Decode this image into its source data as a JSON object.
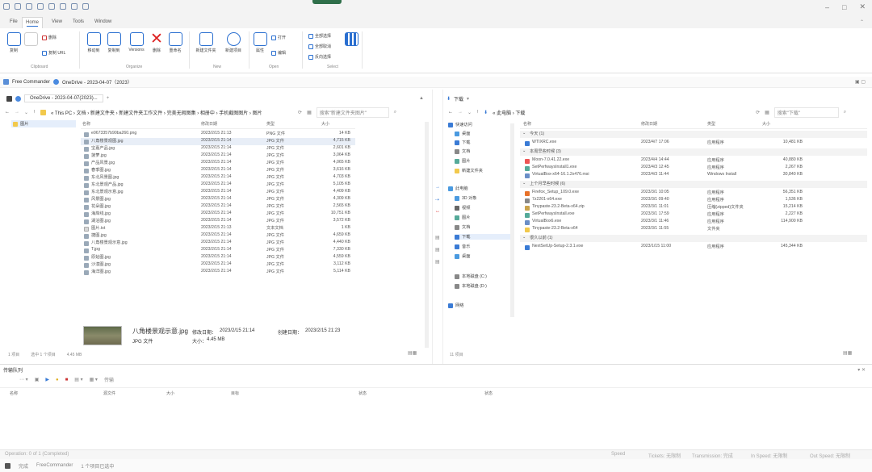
{
  "menu": {
    "file": "File",
    "home": "Home",
    "view": "View",
    "tools": "Tools",
    "window": "Window"
  },
  "ribbon": {
    "buttons": [
      "复制",
      "剪切",
      "移动到",
      "复制到",
      "Versions",
      "删除",
      "重命名",
      "新建文件夹",
      "新建项目",
      "属性"
    ],
    "small": [
      "删除",
      "复制 URL",
      "打开",
      "编辑",
      "全部选择",
      "全部取消",
      "反向选择"
    ],
    "groups": [
      "Clipboard",
      "Organize",
      "New",
      "Open",
      "Select"
    ],
    "sync_label": "同步",
    "partial": "Partial\nsel."
  },
  "address": {
    "text": "Free Commander",
    "cloud": "OneDrive - 2023-04-07（2023）"
  },
  "left": {
    "tab": "OneDrive - 2023-04-07(2023)...",
    "breadcrumb": "« This PC › 文档 › 新建文件夹 › 新建文件夹工作文件 › 完美无瑕图集 › 相册中 › 手机截图图片 › 图片",
    "search_placeholder": "搜索\"新建文件夹图片\"",
    "tree_root": "图片",
    "headers": [
      "名称",
      "修改日期",
      "类型",
      "大小"
    ],
    "files": [
      {
        "name": "e0673357b90ba260.png",
        "date": "2023/2/15 21:13",
        "type": "PNG 文件",
        "size": "14 KB",
        "icon": "img"
      },
      {
        "name": "八角楼景观图.jpg",
        "date": "2023/2/15 21:14",
        "type": "JPG 文件",
        "size": "4,715 KB",
        "icon": "img"
      },
      {
        "name": "宝嘉产品.jpg",
        "date": "2023/2/15 21:14",
        "type": "JPG 文件",
        "size": "2,601 KB",
        "icon": "img"
      },
      {
        "name": "菠萝.jpg",
        "date": "2023/2/15 21:14",
        "type": "JPG 文件",
        "size": "3,064 KB",
        "icon": "img"
      },
      {
        "name": "产品风景.jpg",
        "date": "2023/2/15 21:14",
        "type": "JPG 文件",
        "size": "4,065 KB",
        "icon": "img"
      },
      {
        "name": "春季图.jpg",
        "date": "2023/2/15 21:14",
        "type": "JPG 文件",
        "size": "3,616 KB",
        "icon": "img"
      },
      {
        "name": "东北风景图.jpg",
        "date": "2023/2/15 21:14",
        "type": "JPG 文件",
        "size": "4,703 KB",
        "icon": "img"
      },
      {
        "name": "东北景观产品.jpg",
        "date": "2023/2/15 21:14",
        "type": "JPG 文件",
        "size": "5,105 KB",
        "icon": "img"
      },
      {
        "name": "东北景观示意.jpg",
        "date": "2023/2/15 21:14",
        "type": "JPG 文件",
        "size": "4,409 KB",
        "icon": "img"
      },
      {
        "name": "风景图.jpg",
        "date": "2023/2/15 21:14",
        "type": "JPG 文件",
        "size": "4,309 KB",
        "icon": "img"
      },
      {
        "name": "花朵图.jpg",
        "date": "2023/2/15 21:14",
        "type": "JPG 文件",
        "size": "2,565 KB",
        "icon": "img"
      },
      {
        "name": "海岸线.jpg",
        "date": "2023/2/15 21:14",
        "type": "JPG 文件",
        "size": "10,751 KB",
        "icon": "img"
      },
      {
        "name": "湖泊图.jpg",
        "date": "2023/2/15 21:14",
        "type": "JPG 文件",
        "size": "3,572 KB",
        "icon": "img"
      },
      {
        "name": "图片.txt",
        "date": "2023/2/15 21:13",
        "type": "文本文档",
        "size": "1 KB",
        "icon": "txt"
      },
      {
        "name": "捷图.jpg",
        "date": "2023/2/15 21:14",
        "type": "JPG 文件",
        "size": "4,659 KB",
        "icon": "img"
      },
      {
        "name": "八角楼景观示意.jpg",
        "date": "2023/2/15 21:14",
        "type": "JPG 文件",
        "size": "4,440 KB",
        "icon": "img"
      },
      {
        "name": "T.jpg",
        "date": "2023/2/15 21:14",
        "type": "JPG 文件",
        "size": "7,330 KB",
        "icon": "img"
      },
      {
        "name": "原始图.jpg",
        "date": "2023/2/15 21:14",
        "type": "JPG 文件",
        "size": "4,559 KB",
        "icon": "img"
      },
      {
        "name": "沙漠图.jpg",
        "date": "2023/2/15 21:14",
        "type": "JPG 文件",
        "size": "3,112 KB",
        "icon": "img"
      },
      {
        "name": "海洋图.jpg",
        "date": "2023/2/15 21:14",
        "type": "JPG 文件",
        "size": "5,114 KB",
        "icon": "img"
      }
    ],
    "preview": {
      "name": "八角楼景观示意.jpg",
      "modified_label": "修改日期：",
      "modified": "2023/2/15 21:14",
      "created_label": "创建日期：",
      "created": "2023/2/15 21:23",
      "type": "JPG 文件",
      "size_label": "大小：",
      "size": "4.45 MB"
    },
    "status": [
      "1 项目",
      "选中 1 个项目",
      "4.45 MB"
    ]
  },
  "right": {
    "tab": "下载",
    "breadcrumb": "« 此电脑 › 下载",
    "search_placeholder": "搜索\"下载\"",
    "headers": [
      "名称",
      "修改日期",
      "类型",
      "大小"
    ],
    "tree": [
      "快速访问",
      "桌面",
      "下载",
      "文档",
      "图片",
      "新建文件夹",
      "此电脑",
      "3D 对象",
      "视频",
      "图片",
      "文档",
      "下载",
      "音乐",
      "桌面",
      "本地磁盘 (C:)",
      "本地磁盘 (D:)",
      "网络"
    ],
    "groups": [
      {
        "label": "今天 (1)",
        "files": [
          {
            "name": "WTIXRC.exe",
            "date": "2023/4/7 17:06",
            "type": "应用程序",
            "size": "10,481 KB",
            "icon": "exe"
          }
        ]
      },
      {
        "label": "本周早些时候 (3)",
        "files": [
          {
            "name": "Moon-7.0.41.22.exe",
            "date": "2023/4/4 14:44",
            "type": "应用程序",
            "size": "40,880 KB",
            "icon": "red"
          },
          {
            "name": "SetPerfwaysInstall1.exe",
            "date": "2023/4/3 12:45",
            "type": "应用程序",
            "size": "2,267 KB",
            "icon": "grn"
          },
          {
            "name": "VirtualBox-x64-16.1.2x476.msi",
            "date": "2023/4/3 11:44",
            "type": "Windows Install",
            "size": "30,840 KB",
            "icon": "msi"
          }
        ]
      },
      {
        "label": "上个月早些时候 (6)",
        "files": [
          {
            "name": "Firefox_Setup_109.0.exe",
            "date": "2023/3/1 10:05",
            "type": "应用程序",
            "size": "56,351 KB",
            "icon": "fox"
          },
          {
            "name": "7z2201-x64.exe",
            "date": "2023/3/1 09:40",
            "type": "应用程序",
            "size": "1,536 KB",
            "icon": "gry"
          },
          {
            "name": "Tinypaste-23.2-Beta-x64.zip",
            "date": "2023/3/1 11:01",
            "type": "压缩(zipped)文件夹",
            "size": "15,214 KB",
            "icon": "pkg"
          },
          {
            "name": "SetPerfwaysInstall.exe",
            "date": "2023/3/1 17:59",
            "type": "应用程序",
            "size": "2,227 KB",
            "icon": "grn"
          },
          {
            "name": "VirtualBox6.exe",
            "date": "2023/3/1 11:46",
            "type": "应用程序",
            "size": "114,900 KB",
            "icon": "msi"
          },
          {
            "name": "Tinypaste-23.2-Beta-x64",
            "date": "2023/3/1 11:55",
            "type": "文件夹",
            "size": "",
            "icon": "fold"
          }
        ]
      },
      {
        "label": "很久以前 (1)",
        "files": [
          {
            "name": "NextSetUp-Setup-2.3.1.exe",
            "date": "2023/1/15 11:00",
            "type": "应用程序",
            "size": "145,344 KB",
            "icon": "exe"
          }
        ]
      }
    ],
    "status": [
      "11 项目"
    ]
  },
  "queue": {
    "title": "传输队列",
    "toolbar_label": "传输",
    "headers": [
      "名称",
      "源文件",
      "大小",
      "目标",
      "状态",
      "状态"
    ]
  },
  "bottom": {
    "left": "Operation: 0 of 1 (Completed)",
    "cols": [
      "Speed",
      "Tickets: 无限制",
      "Transmission: 完成",
      "In Speed: 无限制",
      "Out Speed: 无限制"
    ],
    "bar2": [
      "完成",
      "FreeCommander",
      "1 个项目已选中"
    ]
  }
}
